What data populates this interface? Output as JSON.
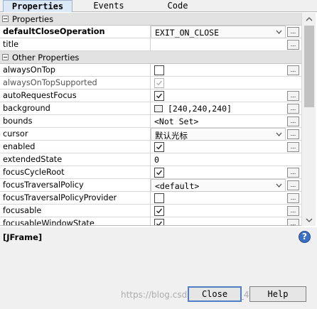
{
  "tabs": [
    "Properties",
    "Events",
    "Code"
  ],
  "categories": [
    "Properties",
    "Other Properties"
  ],
  "properties": [
    {
      "name": "defaultCloseOperation",
      "value": "EXIT_ON_CLOSE"
    },
    {
      "name": "title",
      "value": ""
    }
  ],
  "other_properties": [
    {
      "name": "alwaysOnTop",
      "checked": false
    },
    {
      "name": "alwaysOnTopSupported",
      "checked": true
    },
    {
      "name": "autoRequestFocus",
      "checked": true
    },
    {
      "name": "background",
      "value": "[240,240,240]",
      "color": "#f0f0f0"
    },
    {
      "name": "bounds",
      "value": "<Not Set>"
    },
    {
      "name": "cursor",
      "value": "默认光标"
    },
    {
      "name": "enabled",
      "checked": true
    },
    {
      "name": "extendedState",
      "value": "0"
    },
    {
      "name": "focusCycleRoot",
      "checked": true
    },
    {
      "name": "focusTraversalPolicy",
      "value": "<default>"
    },
    {
      "name": "focusTraversalPolicyProvider",
      "checked": false
    },
    {
      "name": "focusable",
      "checked": true
    },
    {
      "name": "focusableWindowState",
      "checked": true
    }
  ],
  "ellipsis": "...",
  "description": {
    "title": "[JFrame]"
  },
  "help_icon": "?",
  "buttons": {
    "close": "Close",
    "help": "Help"
  },
  "watermark": "https://blog.csdn.net/weixin_45513866"
}
